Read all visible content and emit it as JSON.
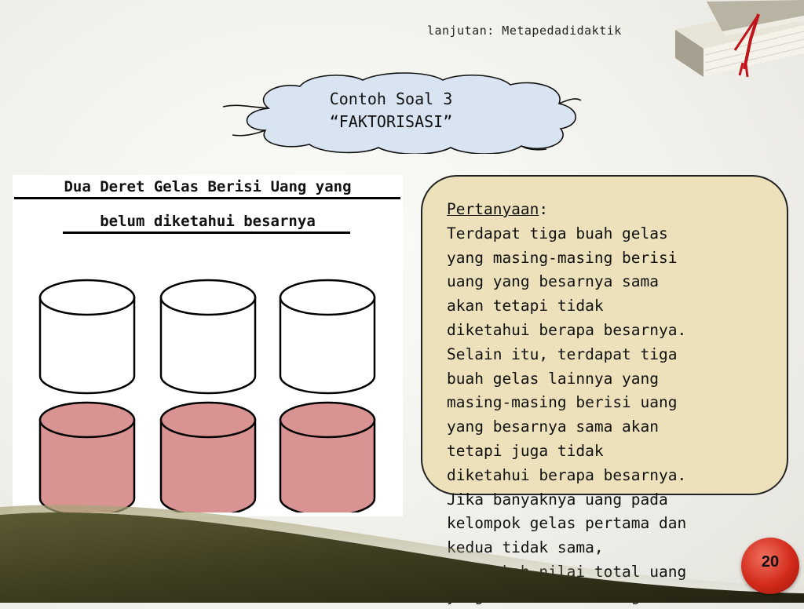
{
  "header": {
    "title": "lanjutan: Metapedadidaktik"
  },
  "cloud": {
    "line1": "Contoh Soal 3",
    "line2": "“FAKTORISASI”"
  },
  "figure": {
    "title_line1": "Dua Deret Gelas Berisi Uang yang",
    "title_line2": "belum diketahui besarnya",
    "rows": [
      {
        "count": 3,
        "fill": "#ffffff"
      },
      {
        "count": 3,
        "fill": "#da9393"
      }
    ]
  },
  "question": {
    "label": "Pertanyaan",
    "label_suffix": ":",
    "body": "Terdapat tiga buah gelas\nyang masing-masing berisi\nuang yang besarnya sama\nakan tetapi tidak\ndiketahui berapa besarnya.\nSelain itu, terdapat tiga\nbuah gelas lainnya yang\nmasing-masing berisi uang\nyang besarnya sama akan\ntetapi juga tidak\ndiketahui berapa besarnya.\nJika banyaknya uang pada\nkelompok gelas pertama dan\nkedua tidak sama,\nberapakah nilai total uang\nyang ada dalam enam gelas"
  },
  "page": {
    "number": "20"
  },
  "colors": {
    "cloud_fill": "#d9e4f2",
    "question_box_fill": "#ece1bb",
    "glass_empty": "#ffffff",
    "glass_filled": "#da9393",
    "badge": "#d22a1a"
  },
  "icons": [
    "books-icon",
    "bookmark-ribbon-icon"
  ]
}
